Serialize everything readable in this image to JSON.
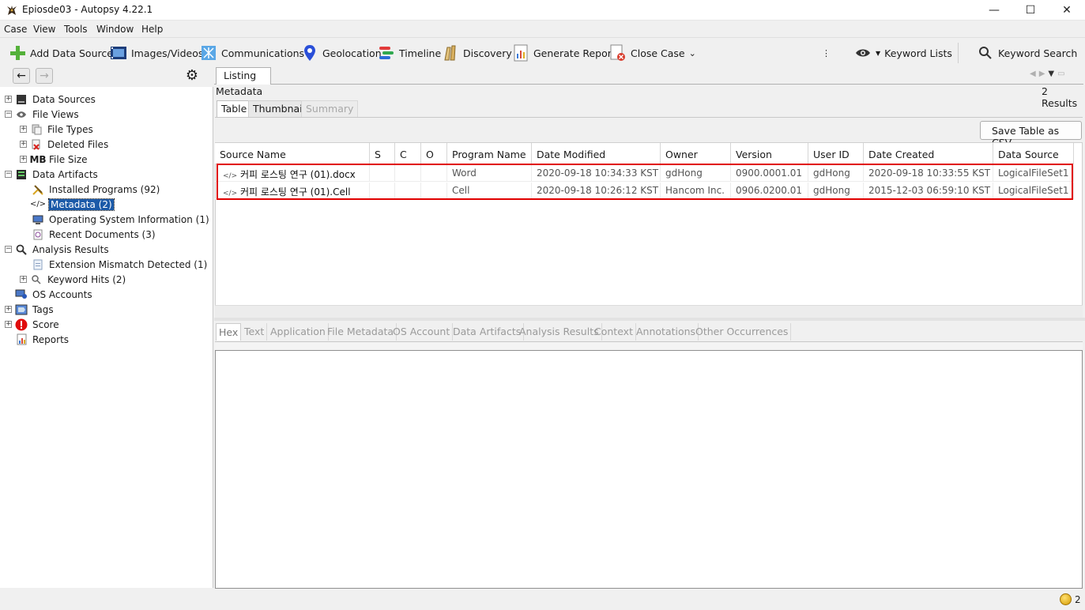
{
  "window": {
    "title": "Epiosde03 - Autopsy 4.22.1",
    "minimize_glyph": "—",
    "maximize_glyph": "☐",
    "close_glyph": "✕"
  },
  "menu": [
    "Case",
    "View",
    "Tools",
    "Window",
    "Help"
  ],
  "toolbar": {
    "add_data_source": "Add Data Source",
    "images_videos": "Images/Videos",
    "communications": "Communications",
    "geolocation": "Geolocation",
    "timeline": "Timeline",
    "discovery": "Discovery",
    "generate_report": "Generate Report",
    "close_case": "Close Case",
    "keyword_lists": "Keyword Lists",
    "keyword_search": "Keyword Search"
  },
  "tree": {
    "data_sources": "Data Sources",
    "file_views": "File Views",
    "file_types": "File Types",
    "deleted_files": "Deleted Files",
    "file_size_prefix": "MB",
    "file_size": "File Size",
    "data_artifacts": "Data Artifacts",
    "installed_programs": "Installed Programs (92)",
    "metadata": "Metadata (2)",
    "os_info": "Operating System Information (1)",
    "recent_documents": "Recent Documents (3)",
    "analysis_results": "Analysis Results",
    "extension_mismatch": "Extension Mismatch Detected (1)",
    "keyword_hits": "Keyword Hits (2)",
    "os_accounts": "OS Accounts",
    "tags": "Tags",
    "score": "Score",
    "reports": "Reports"
  },
  "listing": {
    "tab": "Listing",
    "heading": "Metadata",
    "results_count": "2",
    "results_label": "Results",
    "subtabs": {
      "table": "Table",
      "thumbnail": "Thumbnail",
      "summary": "Summary"
    },
    "save_csv": "Save Table as CSV",
    "columns": [
      "Source Name",
      "S",
      "C",
      "O",
      "Program Name",
      "Date Modified",
      "Owner",
      "Version",
      "User ID",
      "Date Created",
      "Data Source"
    ],
    "rows": [
      [
        "커피 로스팅 연구 (01).docx",
        "",
        "",
        "",
        "Word",
        "2020-09-18 10:34:33 KST",
        "gdHong",
        "0900.0001.01",
        "gdHong",
        "2020-09-18 10:33:55 KST",
        "LogicalFileSet1"
      ],
      [
        "커피 로스팅 연구 (01).Cell",
        "",
        "",
        "",
        "Cell",
        "2020-09-18 10:26:12 KST",
        "Hancom Inc.",
        "0906.0200.01",
        "gdHong",
        "2015-12-03 06:59:10 KST",
        "LogicalFileSet1"
      ]
    ]
  },
  "content_tabs": [
    "Hex",
    "Text",
    "Application",
    "File Metadata",
    "OS Account",
    "Data Artifacts",
    "Analysis Results",
    "Context",
    "Annotations",
    "Other Occurrences"
  ],
  "status": {
    "notifications": "2"
  },
  "colors": {
    "selection": "#1b5aa8",
    "highlight_box": "#e00000"
  }
}
